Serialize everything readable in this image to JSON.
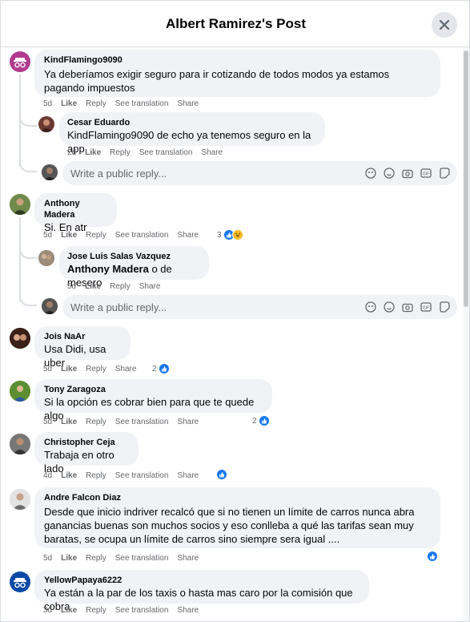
{
  "header": {
    "title": "Albert Ramirez's Post"
  },
  "actions": {
    "like": "Like",
    "reply": "Reply",
    "see_translation": "See translation",
    "share": "Share"
  },
  "reply_box": {
    "placeholder": "Write a public reply..."
  },
  "comments": [
    {
      "author": "KindFlamingo9090",
      "text": "Ya deberíamos exigir seguro para ir cotizando de todos modos ya estamos pagando impuestos",
      "time": "5d"
    },
    {
      "author": "Cesar Eduardo",
      "text": "KindFlamingo9090 de echo ya tenemos seguro en la app",
      "time": "2d"
    },
    {
      "author": "Anthony Madera",
      "text": "Si. En atr",
      "time": "5d",
      "reactions": "3"
    },
    {
      "author": "Jose Luis Salas Vazquez",
      "mention": "Anthony Madera",
      "text": " o de mesero",
      "time": "5d"
    },
    {
      "author": "Jois NaAr",
      "text": "Usa Didi, usa uber",
      "time": "5d",
      "reactions": "2"
    },
    {
      "author": "Tony Zaragoza",
      "text": "Si la opción es cobrar bien para que te quede algo",
      "time": "5d",
      "reactions": "2"
    },
    {
      "author": "Christopher Ceja",
      "text": "Trabaja en otro lado",
      "time": "4d"
    },
    {
      "author": "Andre Falcon Diaz",
      "text": "Desde que inicio indriver recalcó que si no tienen un límite de carros nunca abra ganancias buenas son muchos socios y eso conlleba a qué las tarifas sean muy baratas, se ocupa un límite de carros sino siempre sera igual ....",
      "time": "5d"
    },
    {
      "author": "YellowPapaya6222",
      "text": "Ya están a la par de los taxis o hasta mas caro por la comisión que cobra",
      "time": "3d"
    }
  ],
  "colors": {
    "accent": "#1877f2",
    "bubble": "#f0f2f5",
    "meta": "#65676b"
  }
}
